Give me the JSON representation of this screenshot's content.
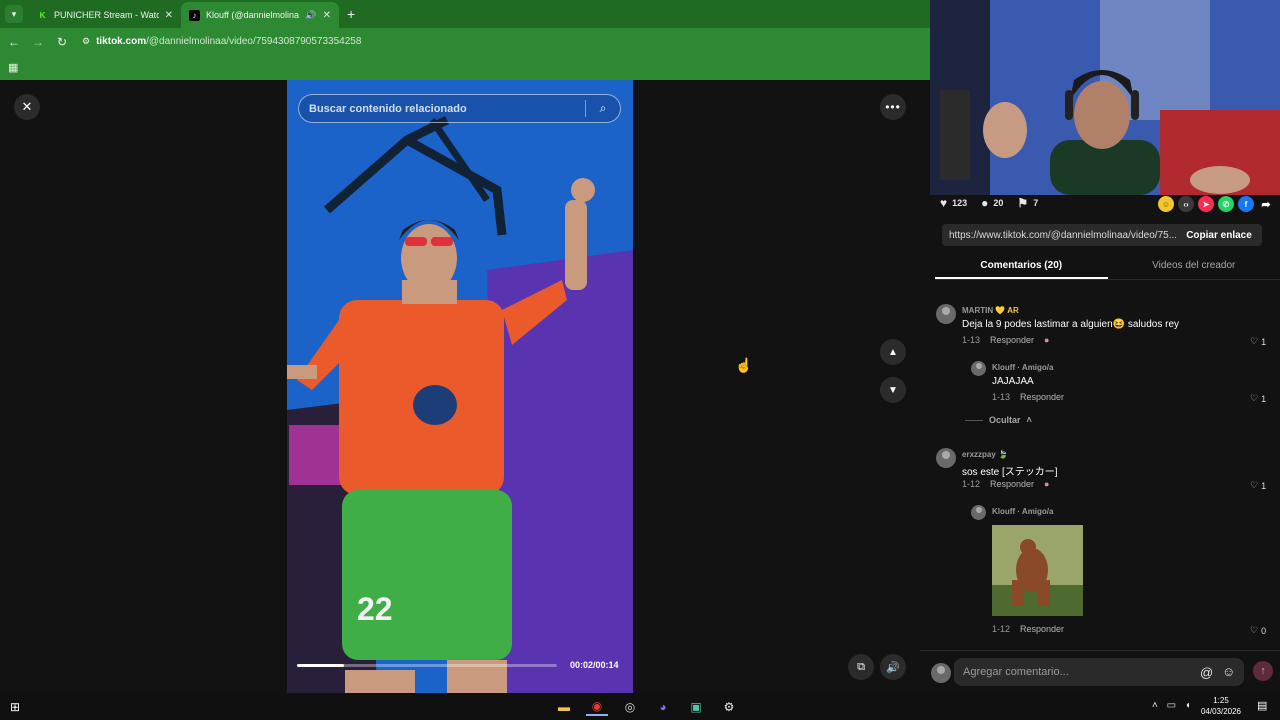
{
  "browser": {
    "tabs": [
      {
        "title": "PUNICHER Stream - Watch Live",
        "favicon": "kick-icon",
        "active": false
      },
      {
        "title": "Klouff (@dannielmolinaa) | TikTok",
        "favicon": "tiktok-icon",
        "active": true
      }
    ],
    "new_tab": "+",
    "url_domain": "tiktok.com",
    "url_path": "/@dannielmolinaa/video/7594308790573354258",
    "accent_color": "#2e8a32"
  },
  "player": {
    "search_placeholder": "Buscar contenido relacionado",
    "time": "00:02/00:14",
    "progress_fraction": 0.18
  },
  "video_stats": {
    "likes": "123",
    "comments": "20",
    "saves": "7"
  },
  "share_link": {
    "url": "https://www.tiktok.com/@dannielmolinaa/video/75...",
    "copy_label": "Copiar enlace"
  },
  "panel_tabs": {
    "comments": "Comentarios (20)",
    "creator_videos": "Videos del creador"
  },
  "comments": [
    {
      "user": "MARTIN",
      "badge": "💛 AR",
      "text": "Deja la 9 podes lastimar a alguien😆 saludos rey",
      "date": "1-13",
      "reply_label": "Responder",
      "likes": "1",
      "replies": [
        {
          "user": "Klouff · Amigo/a",
          "text": "JAJAJAA",
          "date": "1-13",
          "reply_label": "Responder",
          "likes": "1"
        }
      ],
      "hide_label": "Ocultar"
    },
    {
      "user": "erxzzpay",
      "badge": "🍃",
      "text": "sos este [ステッカー]",
      "date": "1-12",
      "reply_label": "Responder",
      "likes": "1",
      "replies": [
        {
          "user": "Klouff · Amigo/a",
          "text": "",
          "date": "1-12",
          "reply_label": "Responder",
          "likes": "0"
        }
      ]
    }
  ],
  "add_comment": {
    "placeholder": "Agregar comentario..."
  },
  "taskbar": {
    "time": "1:25",
    "date": "04/03/2026"
  }
}
